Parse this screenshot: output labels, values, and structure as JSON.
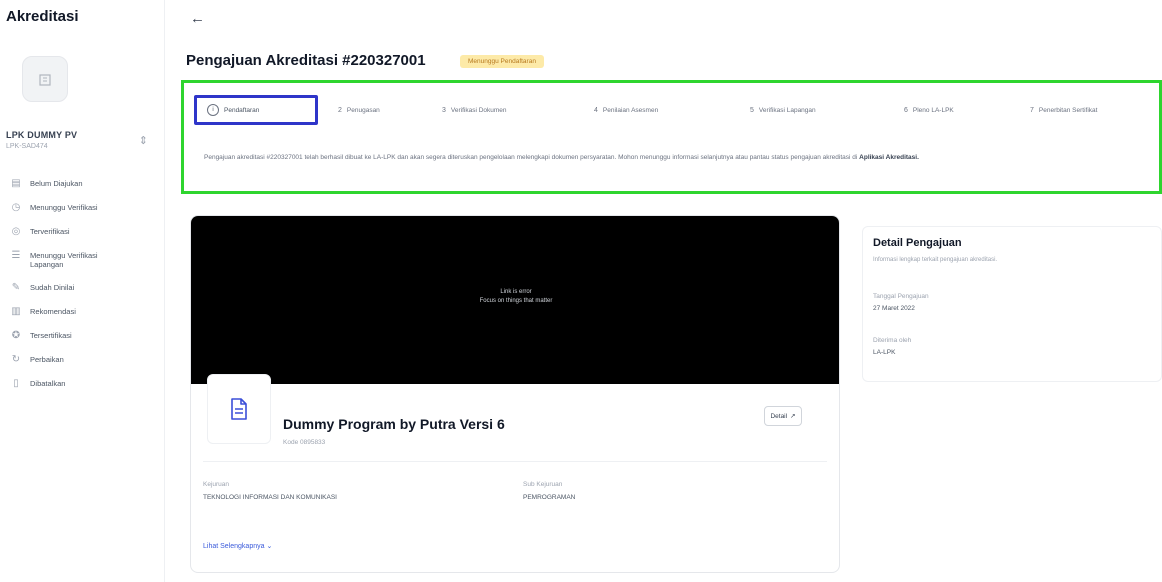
{
  "sidebar": {
    "app_title": "Akreditasi",
    "org_name": "LPK DUMMY PV",
    "org_code": "LPK-SAD474",
    "items": [
      {
        "label": "Belum Diajukan",
        "icon": "document-icon"
      },
      {
        "label": "Menunggu Verifikasi",
        "icon": "clock-icon"
      },
      {
        "label": "Terverifikasi",
        "icon": "check-circle-icon"
      },
      {
        "label": "Menunggu Verifikasi Lapangan",
        "icon": "list-icon"
      },
      {
        "label": "Sudah Dinilai",
        "icon": "edit-icon"
      },
      {
        "label": "Rekomendasi",
        "icon": "chart-icon"
      },
      {
        "label": "Tersertifikasi",
        "icon": "award-icon"
      },
      {
        "label": "Perbaikan",
        "icon": "refresh-icon"
      },
      {
        "label": "Dibatalkan",
        "icon": "trash-icon"
      }
    ]
  },
  "header": {
    "back": "←",
    "title": "Pengajuan Akreditasi #220327001",
    "status_badge": "Menunggu Pendaftaran"
  },
  "steps": {
    "items": [
      {
        "num": "1",
        "label": "Pendaftaran"
      },
      {
        "num": "2",
        "label": "Penugasan"
      },
      {
        "num": "3",
        "label": "Verifikasi Dokumen"
      },
      {
        "num": "4",
        "label": "Penilaian Asesmen"
      },
      {
        "num": "5",
        "label": "Verifikasi Lapangan"
      },
      {
        "num": "6",
        "label": "Pleno LA-LPK"
      },
      {
        "num": "7",
        "label": "Penerbitan Sertifikat"
      }
    ],
    "desc": "Pengajuan akreditasi #220327001 telah berhasil dibuat ke LA-LPK dan akan segera diteruskan pengelolaan melengkapi dokumen persyaratan. Mohon menunggu informasi selanjutnya atau pantau status pengajuan akreditasi di",
    "desc_link": "Aplikasi Akreditasi."
  },
  "video": {
    "line1": "Link is error",
    "line2": "Focus on things that matter"
  },
  "program": {
    "title": "Dummy Program by Putra Versi 6",
    "code": "Kode 0895833",
    "detail_button": "Detail",
    "field1_label": "Kejuruan",
    "field1_value": "TEKNOLOGI INFORMASI DAN KOMUNIKASI",
    "field2_label": "Sub Kejuruan",
    "field2_value": "PEMROGRAMAN",
    "more_link": "Lihat Selengkapnya ⌄"
  },
  "detail": {
    "title": "Detail Pengajuan",
    "subtitle": "Informasi lengkap terkait pengajuan akreditasi.",
    "date_label": "Tanggal Pengajuan",
    "date_value": "27 Maret 2022",
    "by_label": "Diterima oleh",
    "by_value": "LA-LPK"
  }
}
